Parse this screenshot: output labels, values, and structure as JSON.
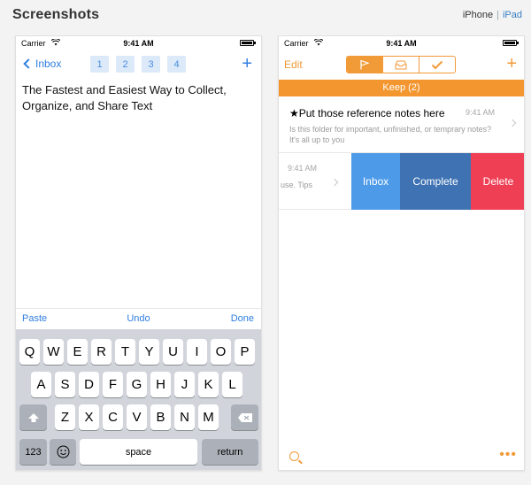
{
  "header": {
    "title": "Screenshots",
    "device_iphone": "iPhone",
    "separator": "|",
    "device_ipad": "iPad"
  },
  "left_phone": {
    "status": {
      "carrier": "Carrier",
      "time": "9:41 AM"
    },
    "nav": {
      "back_label": "Inbox",
      "tabs": [
        "1",
        "2",
        "3",
        "4"
      ],
      "add_label": "+"
    },
    "note_text": "The Fastest and Easiest Way to Collect, Organize, and Share Text",
    "edit_bar": {
      "paste": "Paste",
      "undo": "Undo",
      "done": "Done"
    },
    "keyboard": {
      "row1": [
        "Q",
        "W",
        "E",
        "R",
        "T",
        "Y",
        "U",
        "I",
        "O",
        "P"
      ],
      "row2": [
        "A",
        "S",
        "D",
        "F",
        "G",
        "H",
        "J",
        "K",
        "L"
      ],
      "row3": [
        "Z",
        "X",
        "C",
        "V",
        "B",
        "N",
        "M"
      ],
      "numbers_key": "123",
      "space_key": "space",
      "return_key": "return"
    }
  },
  "right_phone": {
    "status": {
      "carrier": "Carrier",
      "time": "9:41 AM"
    },
    "nav": {
      "edit_label": "Edit",
      "add_label": "+"
    },
    "segments": [
      "flag-icon",
      "inbox-icon",
      "check-icon"
    ],
    "active_segment": 0,
    "folder_header": "Keep (2)",
    "items": [
      {
        "title": "★Put those reference notes here",
        "time": "9:41 AM",
        "snippet": "Is this folder for important, unfinished, or temprary notes? It's all up to you"
      },
      {
        "time": "9:41 AM",
        "snippet": "use. Tips",
        "actions": [
          "Inbox",
          "Complete",
          "Delete"
        ]
      }
    ],
    "bottom": {
      "search": "search-icon",
      "more": "•••"
    }
  },
  "colors": {
    "accent_orange": "#f3962f",
    "accent_blue": "#2f7ee0",
    "inbox_blue": "#4d9be8",
    "complete_blue": "#3e72b3",
    "delete_red": "#ef3f54"
  }
}
